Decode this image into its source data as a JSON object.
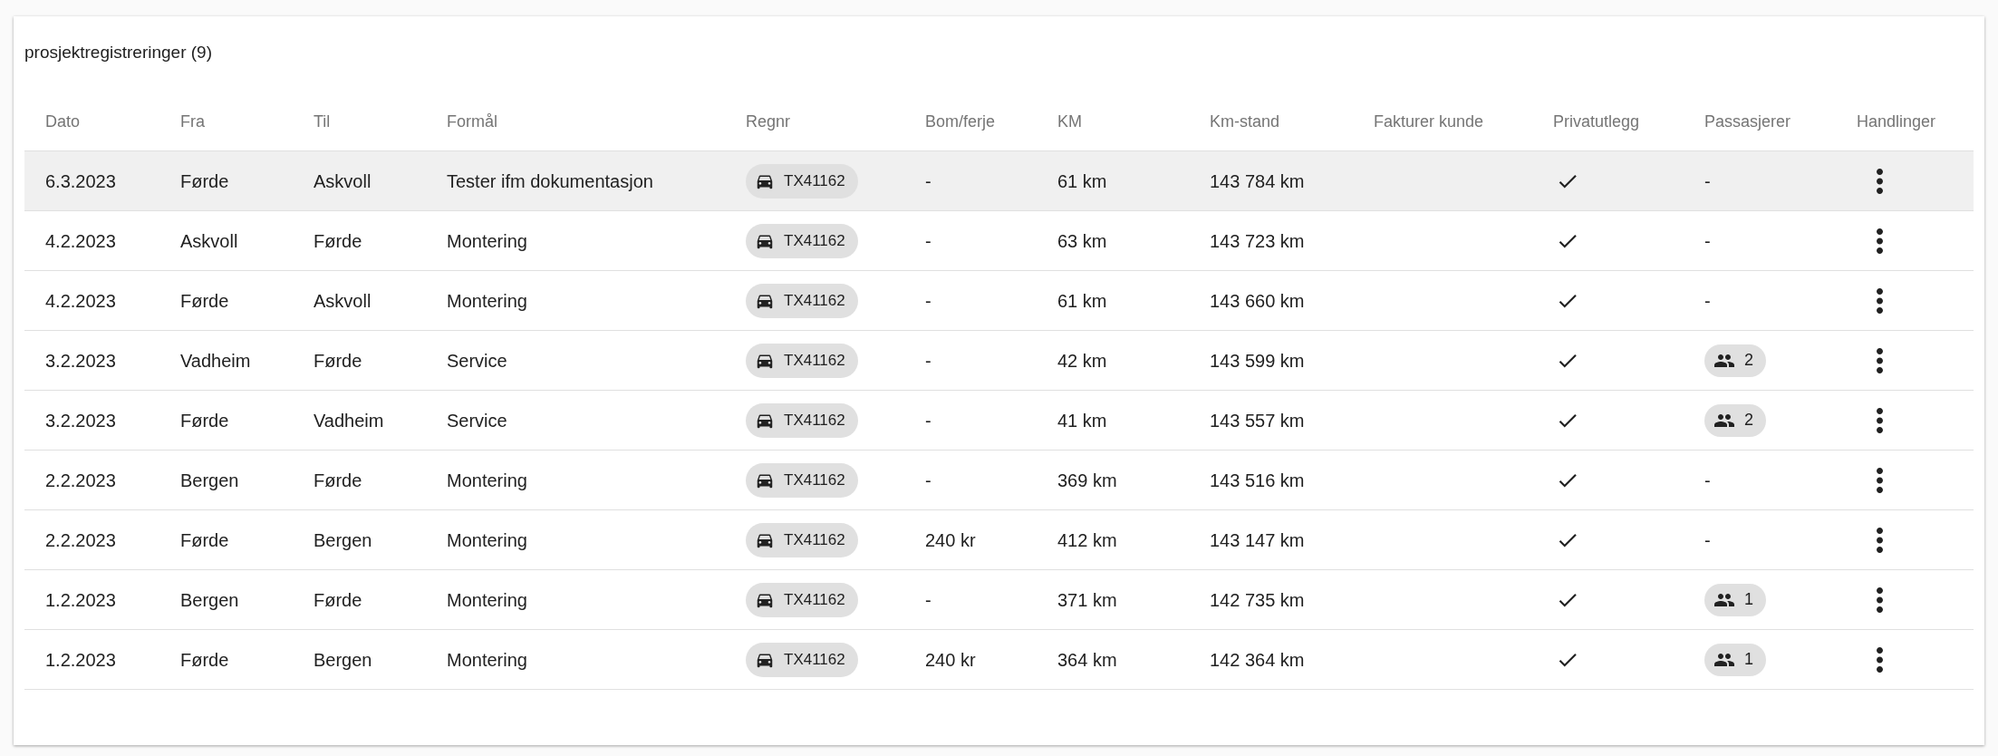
{
  "title": "prosjektregistreringer (9)",
  "columns": [
    "Dato",
    "Fra",
    "Til",
    "Formål",
    "Regnr",
    "Bom/ferje",
    "KM",
    "Km-stand",
    "Fakturer kunde",
    "Privatutlegg",
    "Passasjerer",
    "Handlinger"
  ],
  "rows": [
    {
      "highlighted": true,
      "dato": "6.3.2023",
      "fra": "Førde",
      "til": "Askvoll",
      "formal": "Tester ifm dokumentasjon",
      "regnr": "TX41162",
      "bom": "-",
      "km": "61 km",
      "km_stand": "143 784 km",
      "privatutlegg": true,
      "passengers": {
        "kind": "text",
        "text": "-"
      }
    },
    {
      "highlighted": false,
      "dato": "4.2.2023",
      "fra": "Askvoll",
      "til": "Førde",
      "formal": "Montering",
      "regnr": "TX41162",
      "bom": "-",
      "km": "63 km",
      "km_stand": "143 723 km",
      "privatutlegg": true,
      "passengers": {
        "kind": "text",
        "text": "-"
      }
    },
    {
      "highlighted": false,
      "dato": "4.2.2023",
      "fra": "Førde",
      "til": "Askvoll",
      "formal": "Montering",
      "regnr": "TX41162",
      "bom": "-",
      "km": "61 km",
      "km_stand": "143 660 km",
      "privatutlegg": true,
      "passengers": {
        "kind": "text",
        "text": "-"
      }
    },
    {
      "highlighted": false,
      "dato": "3.2.2023",
      "fra": "Vadheim",
      "til": "Førde",
      "formal": "Service",
      "regnr": "TX41162",
      "bom": "-",
      "km": "42 km",
      "km_stand": "143 599 km",
      "privatutlegg": true,
      "passengers": {
        "kind": "chip",
        "text": "2"
      }
    },
    {
      "highlighted": false,
      "dato": "3.2.2023",
      "fra": "Førde",
      "til": "Vadheim",
      "formal": "Service",
      "regnr": "TX41162",
      "bom": "-",
      "km": "41 km",
      "km_stand": "143 557 km",
      "privatutlegg": true,
      "passengers": {
        "kind": "chip",
        "text": "2"
      }
    },
    {
      "highlighted": false,
      "dato": "2.2.2023",
      "fra": "Bergen",
      "til": "Førde",
      "formal": "Montering",
      "regnr": "TX41162",
      "bom": "-",
      "km": "369 km",
      "km_stand": "143 516 km",
      "privatutlegg": true,
      "passengers": {
        "kind": "text",
        "text": "-"
      }
    },
    {
      "highlighted": false,
      "dato": "2.2.2023",
      "fra": "Førde",
      "til": "Bergen",
      "formal": "Montering",
      "regnr": "TX41162",
      "bom": "240 kr",
      "km": "412 km",
      "km_stand": "143 147 km",
      "privatutlegg": true,
      "passengers": {
        "kind": "text",
        "text": "-"
      }
    },
    {
      "highlighted": false,
      "dato": "1.2.2023",
      "fra": "Bergen",
      "til": "Førde",
      "formal": "Montering",
      "regnr": "TX41162",
      "bom": "-",
      "km": "371 km",
      "km_stand": "142 735 km",
      "privatutlegg": true,
      "passengers": {
        "kind": "chip",
        "text": "1"
      }
    },
    {
      "highlighted": false,
      "dato": "1.2.2023",
      "fra": "Førde",
      "til": "Bergen",
      "formal": "Montering",
      "regnr": "TX41162",
      "bom": "240 kr",
      "km": "364 km",
      "km_stand": "142 364 km",
      "privatutlegg": true,
      "passengers": {
        "kind": "chip",
        "text": "1"
      }
    }
  ]
}
